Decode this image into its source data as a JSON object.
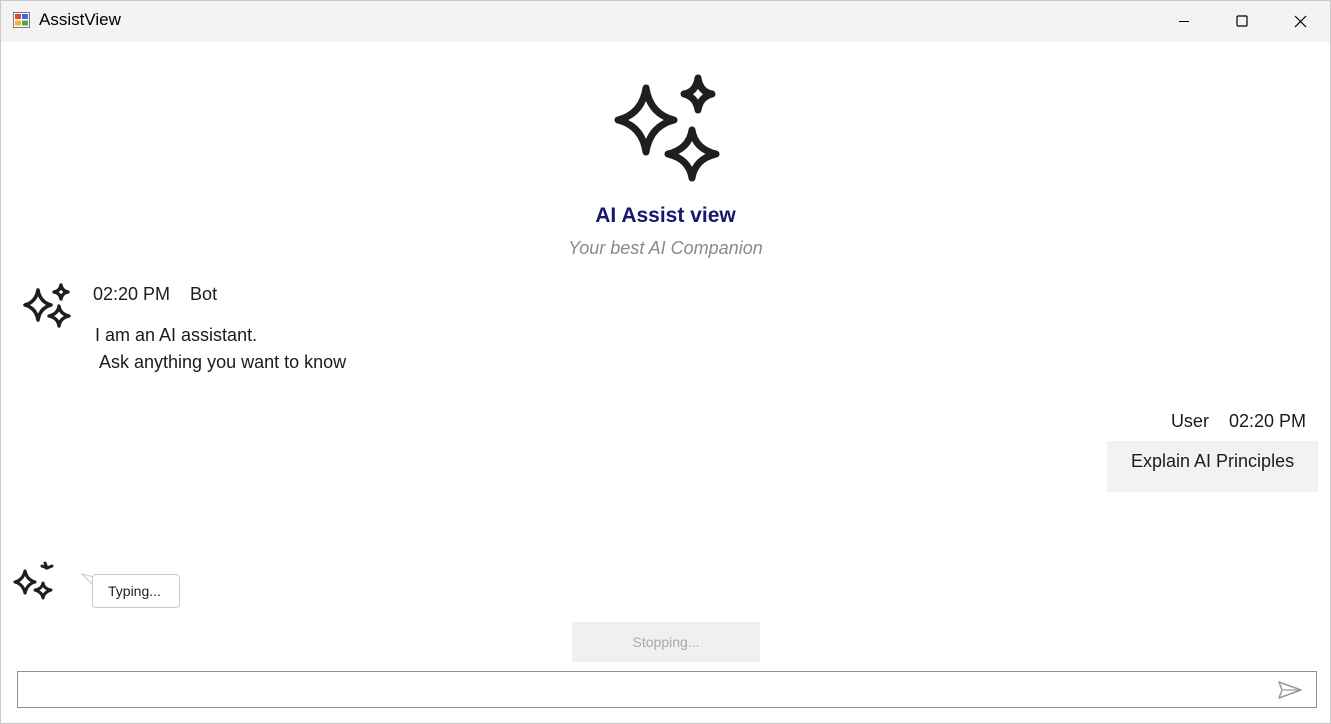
{
  "window": {
    "title": "AssistView",
    "controls": {
      "minimize": "minimize",
      "maximize": "maximize",
      "close": "close"
    }
  },
  "header": {
    "icon": "sparkle-icon",
    "title": "AI Assist view",
    "subtitle": "Your best AI Companion",
    "title_color": "#15186e"
  },
  "messages": [
    {
      "author": "Bot",
      "time": "02:20 PM",
      "meta": "02:20 PM    Bot",
      "text": "I am an AI assistant.\n Ask anything you want to know",
      "avatar": "sparkle-icon"
    },
    {
      "author": "User",
      "time": "02:20 PM",
      "meta": "User    02:20 PM",
      "text": "Explain AI Principles"
    }
  ],
  "typing_indicator": {
    "text": "Typing...",
    "avatar": "sparkle-icon"
  },
  "stop_button": {
    "label": "Stopping..."
  },
  "composer": {
    "placeholder": "",
    "value": "",
    "send_icon": "send-icon"
  }
}
